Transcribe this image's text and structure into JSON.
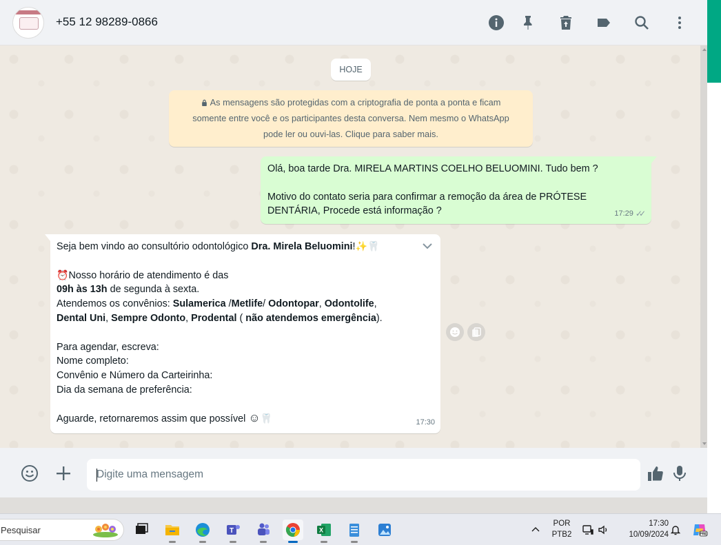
{
  "header": {
    "contact": "+55 12 98289-0866"
  },
  "chat": {
    "date_chip": "HOJE",
    "encryption_notice": {
      "line1": "As mensagens são protegidas com a criptografia de ponta a ponta e ficam",
      "line2": "somente entre você e os participantes desta conversa. Nem mesmo o WhatsApp",
      "line3": "pode ler ou ouvi-las. Clique para saber mais."
    },
    "outgoing": {
      "line1": "Olá, boa tarde Dra. MIRELA MARTINS COELHO BELUOMINI. Tudo bem ?",
      "line2": "Motivo do contato seria para confirmar a remoção da área de  PRÓTESE",
      "line3": "DENTÁRIA, Procede está informação ?",
      "time": "17:29"
    },
    "incoming": {
      "l1_pre": "Seja bem vindo ao consultório odontológico ",
      "l1_bold": "Dra. Mirela Beluomini",
      "l1_post": "!",
      "l2": "Nosso horário de atendimento é das",
      "l3_bold": "09h às 13h",
      "l3_post": " de segunda à sexta.",
      "l4_pre": "Atendemos os convênios: ",
      "l4_b1": "Sulamerica",
      "l4_s1": " /",
      "l4_b2": "Metlife",
      "l4_s2": "/ ",
      "l4_b3": "Odontopar",
      "l4_s3": ", ",
      "l4_b4": "Odontolife",
      "l4_s4": ",",
      "l5_b1": "Dental Uni",
      "l5_s1": ", ",
      "l5_b2": "Sempre Odonto",
      "l5_s2": ", ",
      "l5_b3": "Prodental",
      "l5_s3": " ( ",
      "l5_b4": "não atendemos emergência",
      "l5_s4": ").",
      "l6": "Para agendar, escreva:",
      "l7": "Nome completo:",
      "l8": "Convênio e Número da Carteirinha:",
      "l9": "Dia da semana de preferência:",
      "l10": "Aguarde, retornaremos assim que possível ",
      "time": "17:30"
    }
  },
  "composer": {
    "placeholder": "Digite uma mensagem"
  },
  "taskbar": {
    "search_label": "Pesquisar",
    "lang_line1": "POR",
    "lang_line2": "PTB2",
    "time": "17:30",
    "date": "10/09/2024"
  },
  "icons": {
    "header": [
      "info-icon",
      "pin-icon",
      "trash-icon",
      "label-icon",
      "search-icon",
      "menu-dots-icon"
    ],
    "composer": [
      "emoji-icon",
      "plus-icon",
      "thumbs-up-icon",
      "microphone-icon"
    ]
  },
  "colors": {
    "accent": "#00a884",
    "outgoing_bubble": "#d9fdd3",
    "notice_bg": "#ffeecd",
    "chat_bg": "#efeae2"
  }
}
